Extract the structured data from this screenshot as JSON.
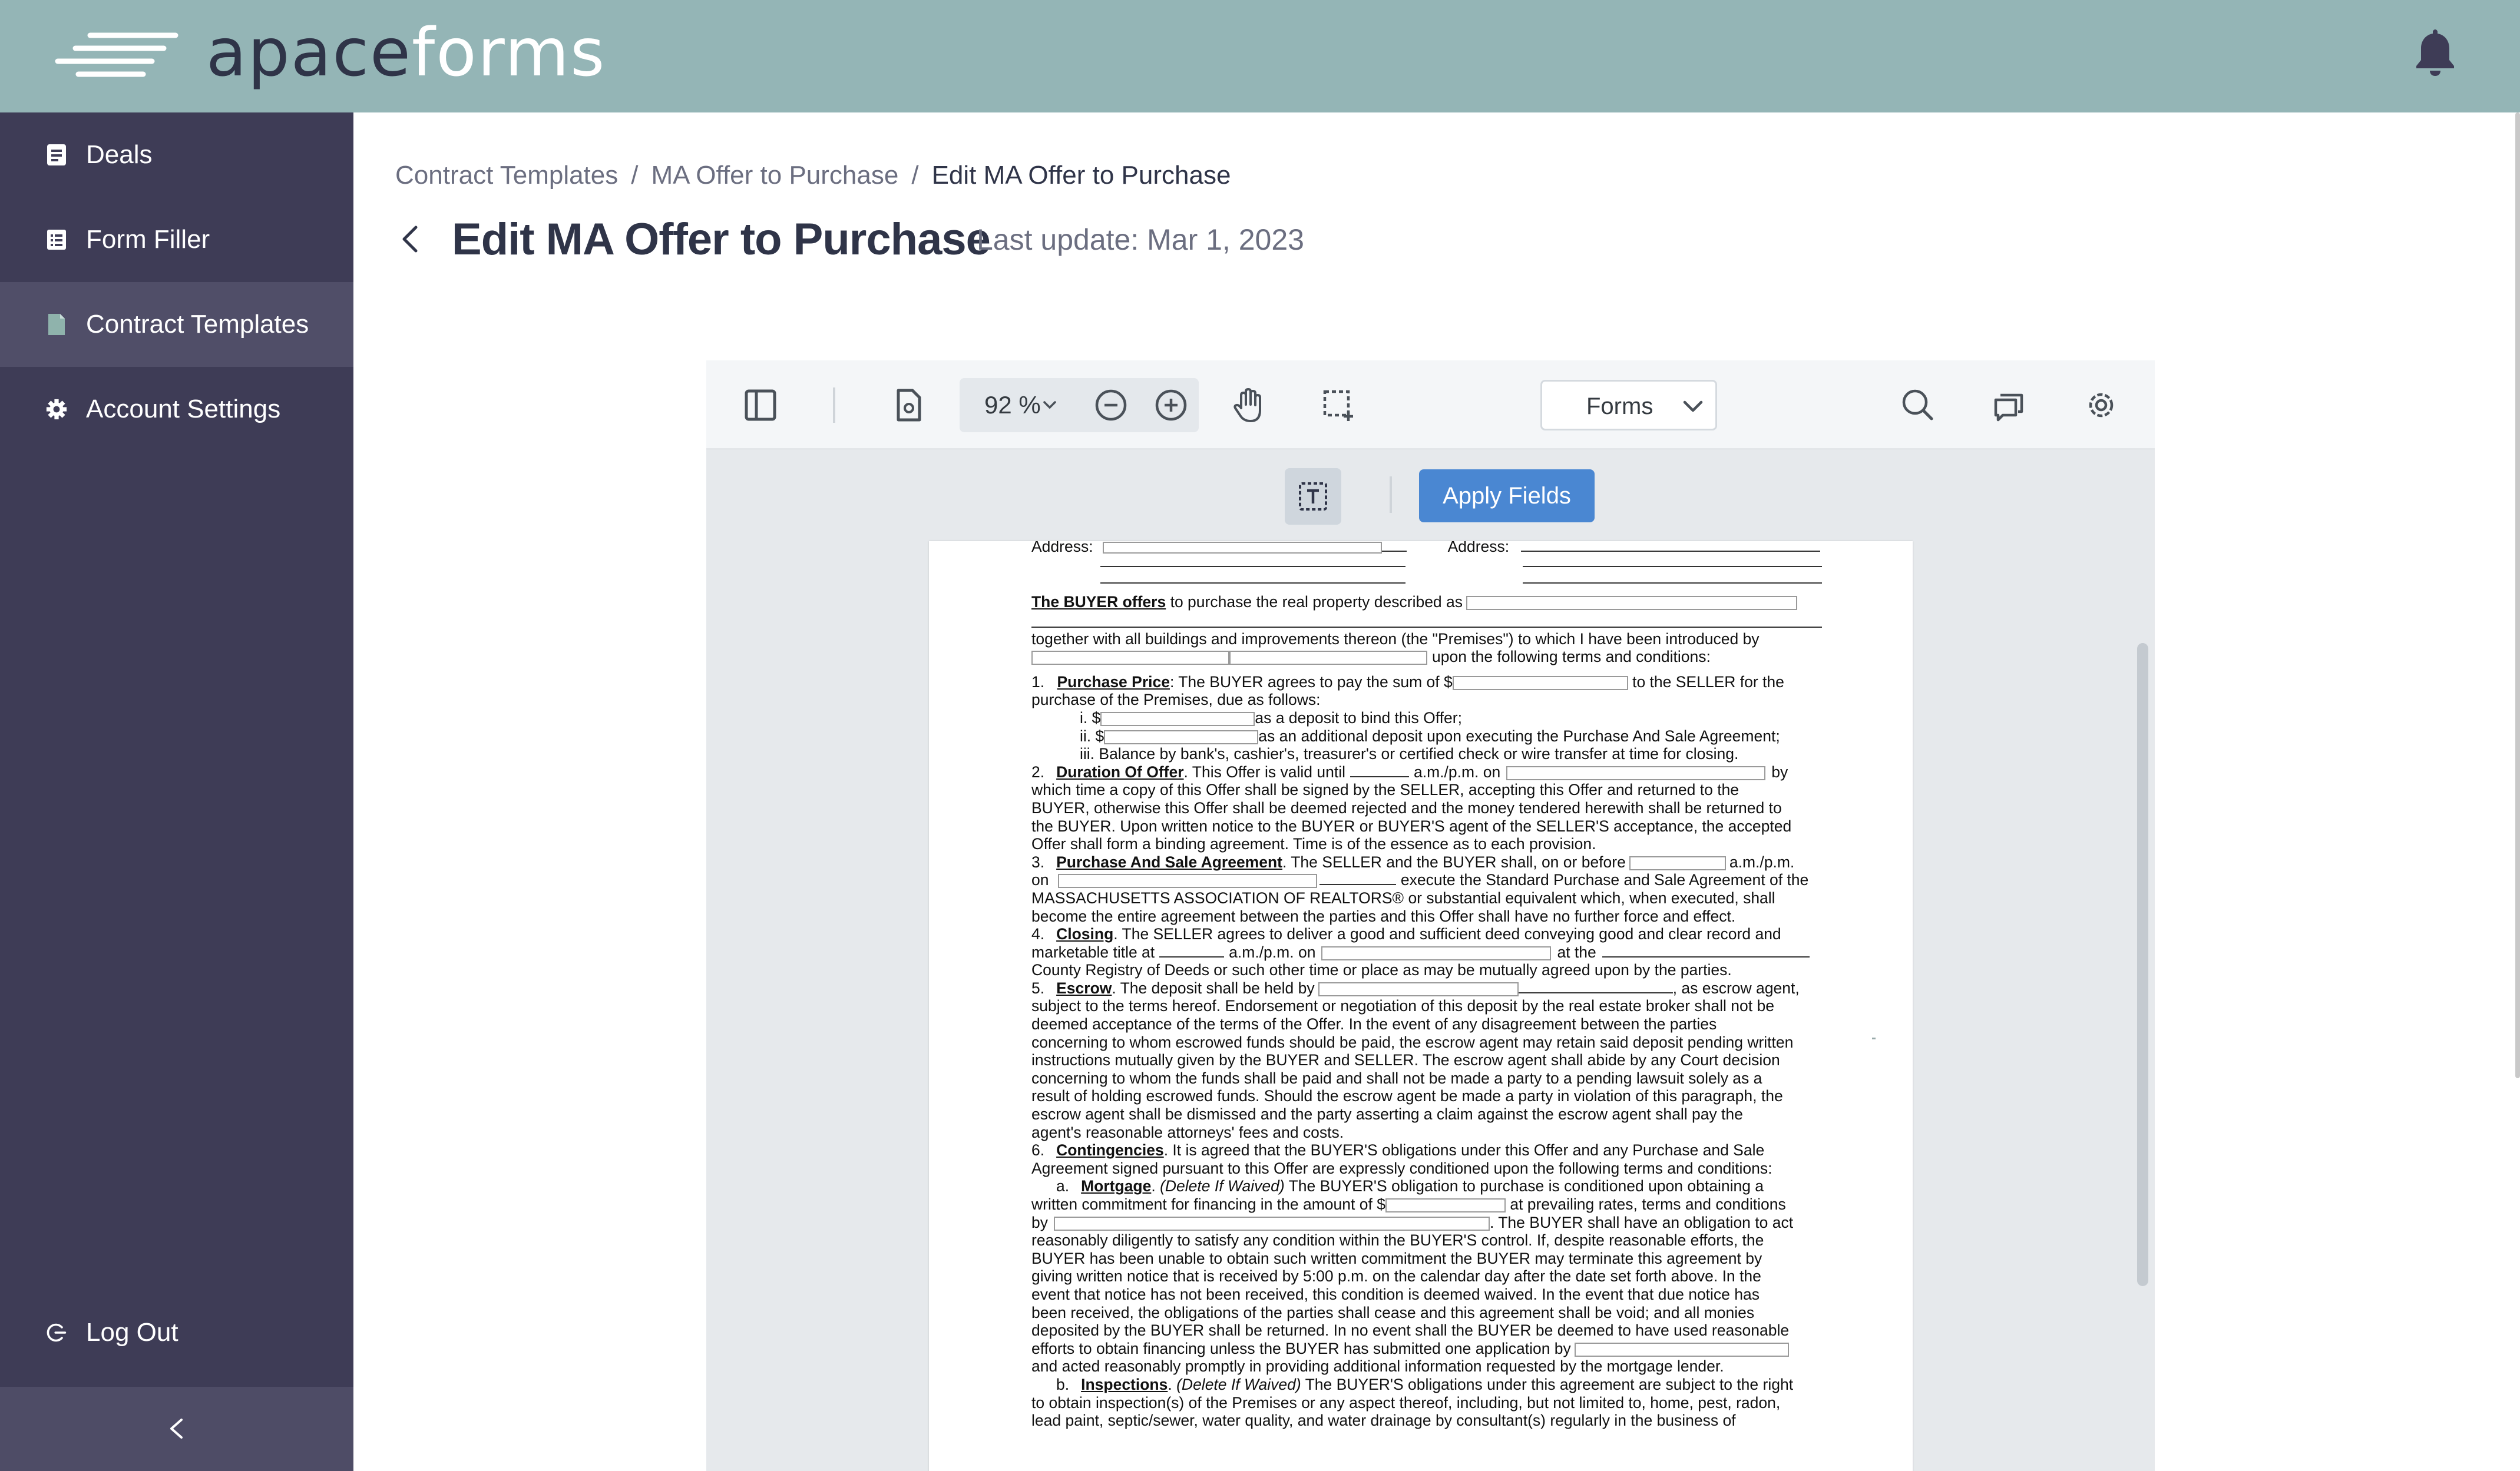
{
  "app": {
    "logo": {
      "part1": "apace",
      "part2": "forms"
    }
  },
  "sidebar": {
    "items": [
      {
        "label": "Deals",
        "icon": "document-list-icon"
      },
      {
        "label": "Form Filler",
        "icon": "form-list-icon"
      },
      {
        "label": "Contract Templates",
        "icon": "file-icon",
        "active": true
      },
      {
        "label": "Account Settings",
        "icon": "gear-icon"
      }
    ],
    "logout": "Log Out"
  },
  "breadcrumb": {
    "items": [
      "Contract Templates",
      "MA Offer to Purchase",
      "Edit MA Offer to Purchase"
    ],
    "separator": "/"
  },
  "header": {
    "title": "Edit MA Offer to Purchase",
    "last_update": "Last update: Mar 1, 2023"
  },
  "viewer": {
    "zoom": "92 %",
    "mode_select": "Forms",
    "apply_button": "Apply Fields"
  },
  "document": {
    "lines": {
      "address_left": "Address:",
      "address_right": "Address:",
      "offer_bold": "The BUYER offers",
      "offer_rest": " to purchase the real property described as",
      "together": "together with all buildings and improvements thereon (the \"Premises\") to which I have been introduced by",
      "upon": "upon the following terms and conditions:",
      "p1_num": "1.",
      "p1_head": "Purchase Price",
      "p1_a": ":  The BUYER agrees to pay the sum of $",
      "p1_b": " to the SELLER for the",
      "p1_c": "purchase of the Premises, due as follows:",
      "p1_i": "i.   $",
      "p1_i_rest": "as a deposit to bind this Offer;",
      "p1_ii": "ii.  $",
      "p1_ii_rest": "as an additional deposit upon executing the Purchase And Sale Agreement;",
      "p1_iii": "iii.  Balance by bank's, cashier's, treasurer's or certified check or wire transfer at time for closing.",
      "p2_num": "2.",
      "p2_head": "Duration Of Offer",
      "p2_a": ".  This Offer is valid until",
      "p2_b": "a.m./p.m. on",
      "p2_c": "by",
      "p2_d": "which time a copy of this Offer shall be signed by the SELLER, accepting this Offer and returned to the",
      "p2_e": "BUYER, otherwise this Offer shall be deemed rejected and the money tendered herewith shall be returned to",
      "p2_f": "the BUYER.  Upon written notice to the BUYER or BUYER'S agent of the SELLER'S acceptance, the accepted",
      "p2_g": "Offer shall form a binding agreement. Time is of the essence as to each provision.",
      "p3_num": "3.",
      "p3_head": "Purchase And Sale Agreement",
      "p3_a": ".  The SELLER and the BUYER shall, on or before",
      "p3_b": "a.m./p.m.",
      "p3_c": "on",
      "p3_d": "execute the Standard Purchase and Sale Agreement of the",
      "p3_e": "MASSACHUSETTS ASSOCIATION OF REALTORS® or substantial equivalent which, when executed, shall",
      "p3_f": "become the entire agreement between the parties and this Offer shall have no further force and effect.",
      "p4_num": "4.",
      "p4_head": "Closing",
      "p4_a": ".  The SELLER agrees to deliver a good and sufficient deed conveying good and clear record and",
      "p4_b": "marketable title at",
      "p4_c": "a.m./p.m. on",
      "p4_d": "at the",
      "p4_e": "County Registry of Deeds or such other time or place as may be mutually agreed upon by the parties.",
      "p5_num": "5.",
      "p5_head": "Escrow",
      "p5_a": ".  The deposit shall be held by",
      "p5_b": ", as escrow agent,",
      "p5_c": "subject to the terms hereof.  Endorsement or negotiation of this deposit by the real estate broker shall not be",
      "p5_d": "deemed acceptance of the terms of the Offer.  In the event of any disagreement between the parties",
      "p5_e": "concerning to whom escrowed funds should be paid, the escrow agent may retain said deposit pending written",
      "p5_f": "instructions mutually given by the BUYER and SELLER.  The escrow agent shall abide by any Court decision",
      "p5_g": "concerning to whom the funds shall be paid and shall not be made a party to a pending lawsuit solely as a",
      "p5_h": "result of holding escrowed funds.  Should the escrow agent be made a party in violation of this paragraph, the",
      "p5_i": "escrow agent shall be dismissed and the party asserting a claim against the escrow agent shall pay the",
      "p5_j": "agent's reasonable attorneys' fees and costs.",
      "p6_num": "6.",
      "p6_head": "Contingencies",
      "p6_a": ".  It is agreed that the BUYER'S obligations under this Offer and any Purchase and Sale",
      "p6_b": "Agreement signed pursuant to this Offer are expressly conditioned upon the following terms and conditions:",
      "p6a_num": "a.",
      "p6a_head": "Mortgage",
      "p6a_waived": "(Delete If Waived)",
      "p6a_a": "  The BUYER'S obligation to purchase is conditioned upon obtaining a",
      "p6a_b": "written commitment for financing in the amount of $",
      "p6a_c": " at prevailing rates, terms and conditions",
      "p6a_d": "by",
      "p6a_e": ".  The BUYER shall have an obligation to act",
      "p6a_f": "reasonably diligently to satisfy any condition within the BUYER'S control.  If, despite reasonable efforts, the",
      "p6a_g": "BUYER has been unable to obtain such written commitment the BUYER may terminate this agreement by",
      "p6a_h": "giving written notice that is received by 5:00 p.m. on the calendar day after the date set forth above.  In the",
      "p6a_i": "event that notice has not been received, this condition is deemed waived.  In the event that due notice has",
      "p6a_j": "been received, the obligations of the parties shall cease and this agreement shall be void; and all monies",
      "p6a_k": "deposited by the BUYER shall be returned.  In no event shall the BUYER be deemed to have used reasonable",
      "p6a_l": "efforts to obtain financing unless the BUYER has submitted one application by",
      "p6a_m": "and acted reasonably promptly in providing additional information requested by the mortgage lender.",
      "p6b_num": "b.",
      "p6b_head": "Inspections",
      "p6b_waived": "(Delete If Waived)",
      "p6b_a": " The BUYER'S obligations under this agreement are subject to the right",
      "p6b_b": "to obtain inspection(s) of the Premises or any aspect thereof, including, but not limited to,  home,  pest,  radon,",
      "p6b_c": "lead paint,  septic/sewer,  water  quality,  and  water  drainage  by  consultant(s)  regularly  in  the  business  of"
    }
  }
}
